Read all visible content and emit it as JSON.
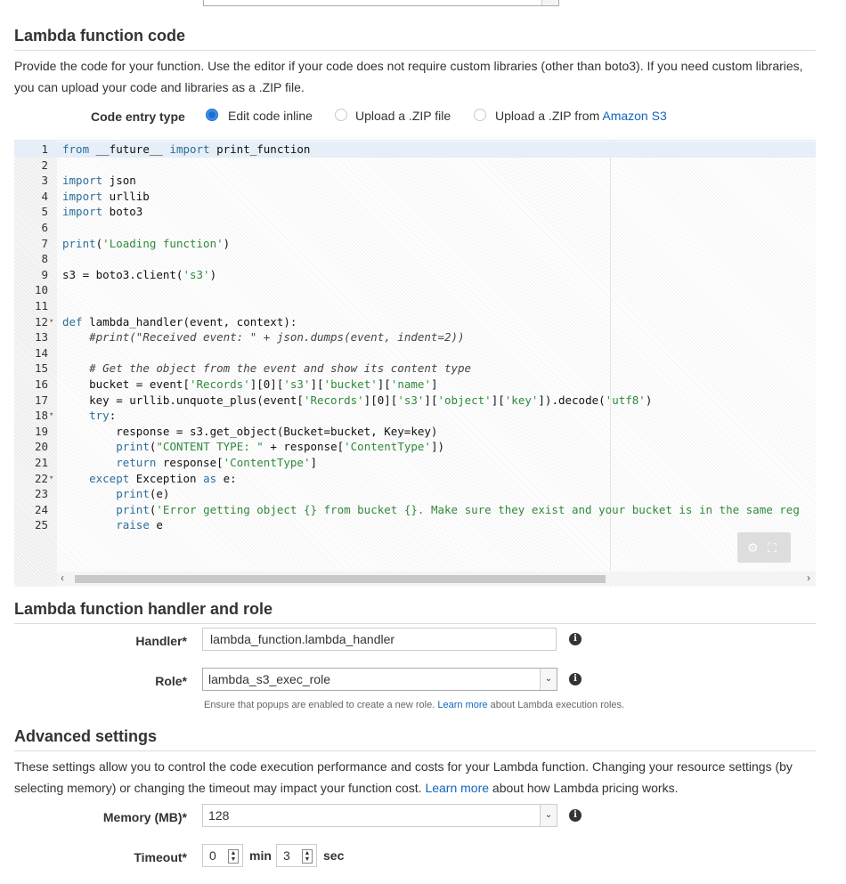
{
  "code_section": {
    "title": "Lambda function code",
    "description_line1": "Provide the code for your function. Use the editor if your code does not require custom libraries (other than boto3). If you need custom libraries,",
    "description_line2": "you can upload your code and libraries as a .ZIP file.",
    "entry_type_label": "Code entry type",
    "options": [
      {
        "label": "Edit code inline",
        "selected": true
      },
      {
        "label": "Upload a .ZIP file",
        "selected": false
      },
      {
        "label": "Upload a .ZIP from ",
        "link": "Amazon S3",
        "selected": false
      }
    ]
  },
  "editor": {
    "line_numbers": [
      "1",
      "2",
      "3",
      "4",
      "5",
      "6",
      "7",
      "8",
      "9",
      "10",
      "11",
      "12",
      "13",
      "14",
      "15",
      "16",
      "17",
      "18",
      "19",
      "20",
      "21",
      "22",
      "23",
      "24",
      "25"
    ],
    "active_line": 1,
    "fold_lines": [
      12,
      18,
      22
    ],
    "code_lines": [
      "from __future__ import print_function",
      "",
      "import json",
      "import urllib",
      "import boto3",
      "",
      "print('Loading function')",
      "",
      "s3 = boto3.client('s3')",
      "",
      "",
      "def lambda_handler(event, context):",
      "    #print(\"Received event: \" + json.dumps(event, indent=2))",
      "",
      "    # Get the object from the event and show its content type",
      "    bucket = event['Records'][0]['s3']['bucket']['name']",
      "    key = urllib.unquote_plus(event['Records'][0]['s3']['object']['key']).decode('utf8')",
      "    try:",
      "        response = s3.get_object(Bucket=bucket, Key=key)",
      "        print(\"CONTENT TYPE: \" + response['ContentType'])",
      "        return response['ContentType']",
      "    except Exception as e:",
      "        print(e)",
      "        print('Error getting object {} from bucket {}. Make sure they exist and your bucket is in the same reg",
      "        raise e"
    ],
    "scroll_left": "‹",
    "scroll_right": "›",
    "settings_icon": "gear-icon",
    "fullscreen_icon": "expand-icon"
  },
  "handler_section": {
    "title": "Lambda function handler and role",
    "handler_label": "Handler*",
    "handler_value": "lambda_function.lambda_handler",
    "role_label": "Role*",
    "role_value": "lambda_s3_exec_role",
    "help_prefix": "Ensure that popups are enabled to create a new role. ",
    "help_link": "Learn more",
    "help_suffix": " about Lambda execution roles."
  },
  "advanced_section": {
    "title": "Advanced settings",
    "description_line1": "These settings allow you to control the code execution performance and costs for your Lambda function. Changing your resource settings (by",
    "description_line2_prefix": "selecting memory) or changing the timeout may impact your function cost. ",
    "description_link": "Learn more",
    "description_line2_suffix": " about how Lambda pricing works.",
    "memory_label": "Memory (MB)*",
    "memory_value": "128",
    "timeout_label": "Timeout*",
    "timeout_min_value": "0",
    "timeout_min_unit": "min",
    "timeout_sec_value": "3",
    "timeout_sec_unit": "sec"
  },
  "colors": {
    "link": "#1166bb",
    "radio_selected": "#1a6fd6",
    "keyword": "#2b6e9c",
    "string": "#2f8a3b"
  }
}
